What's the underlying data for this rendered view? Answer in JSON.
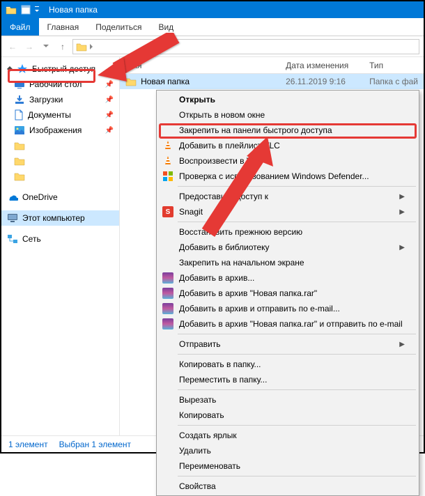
{
  "title": "Новая папка",
  "ribbon": {
    "file": "Файл",
    "home": "Главная",
    "share": "Поделиться",
    "view": "Вид"
  },
  "sidebar": {
    "quick": "Быстрый доступ",
    "items": [
      {
        "label": "Рабочий стол"
      },
      {
        "label": "Загрузки"
      },
      {
        "label": "Документы"
      },
      {
        "label": "Изображения"
      }
    ],
    "onedrive": "OneDrive",
    "thispc": "Этот компьютер",
    "network": "Сеть"
  },
  "columns": {
    "name": "Имя",
    "date": "Дата изменения",
    "type": "Тип"
  },
  "row": {
    "name": "Новая папка",
    "date": "26.11.2019 9:16",
    "type": "Папка с фай"
  },
  "status": {
    "count": "1 элемент",
    "sel": "Выбран 1 элемент"
  },
  "ctx": {
    "open": "Открыть",
    "open_new": "Открыть в новом окне",
    "pin_quick": "Закрепить на панели быстрого доступа",
    "vlc_add": "Добавить в плейлист VLC",
    "vlc_play": "Воспроизвести в VLC",
    "defender": "Проверка с использованием Windows Defender...",
    "share_to": "Предоставить доступ к",
    "snagit": "Snagit",
    "restore": "Восстановить прежнюю версию",
    "library": "Добавить в библиотеку",
    "pin_start": "Закрепить на начальном экране",
    "rar_add": "Добавить в архив...",
    "rar_add_name": "Добавить в архив \"Новая папка.rar\"",
    "rar_mail": "Добавить в архив и отправить по e-mail...",
    "rar_mail_name": "Добавить в архив \"Новая папка.rar\" и отправить по e-mail",
    "sendto": "Отправить",
    "copyto": "Копировать в папку...",
    "moveto": "Переместить в папку...",
    "cut": "Вырезать",
    "copy": "Копировать",
    "shortcut": "Создать ярлык",
    "delete": "Удалить",
    "rename": "Переименовать",
    "props": "Свойства"
  }
}
